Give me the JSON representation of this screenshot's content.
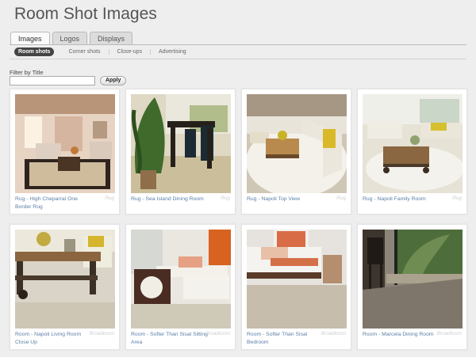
{
  "page": {
    "title": "Room Shot Images"
  },
  "tabs": [
    "Images",
    "Logos",
    "Displays"
  ],
  "subnav": [
    "Room shots",
    "Corner shots",
    "Close-ups",
    "Advertising"
  ],
  "filter": {
    "label": "Filter by Title",
    "value": "",
    "apply_label": "Apply"
  },
  "cards": [
    {
      "caption": "Rug - High Cheparral One Border Rug",
      "tag": "Rug"
    },
    {
      "caption": "Rug - Sea Island Dining Room",
      "tag": "Rug"
    },
    {
      "caption": "Rug - Napoli Top View",
      "tag": "Rug"
    },
    {
      "caption": "Rug - Napoli Family Room",
      "tag": "Rug"
    },
    {
      "caption": "Room - Napoli Living Room Close Up",
      "tag": "Broadloom"
    },
    {
      "caption": "Room - Softer Than Sisal Sitting Area",
      "tag": "Broadloom"
    },
    {
      "caption": "Room - Softer Than Sisal Bedroom",
      "tag": "Broadloom"
    },
    {
      "caption": "Room - Marcela Dining Room",
      "tag": "Broadloom"
    }
  ]
}
